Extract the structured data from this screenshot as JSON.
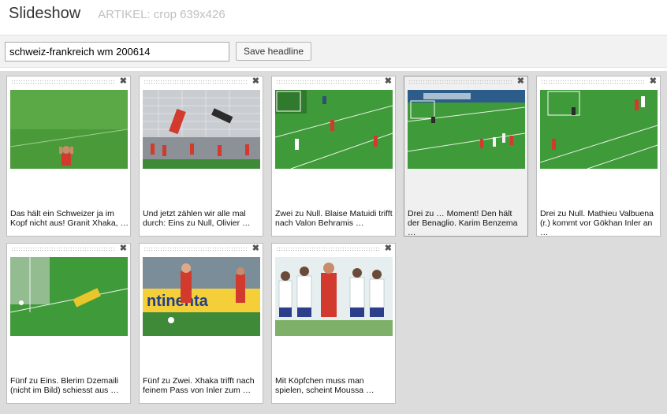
{
  "header": {
    "title": "Slideshow",
    "subtitle": "ARTIKEL: crop 639x426"
  },
  "toolbar": {
    "headline_value": "schweiz-frankreich wm 200614",
    "save_label": "Save headline"
  },
  "slides": [
    {
      "caption": "Das hält ein Schweizer ja im Kopf nicht aus! Granit Xhaka, …",
      "close": "✖"
    },
    {
      "caption": "Und jetzt zählen wir alle mal durch: Eins zu Null, Olivier …",
      "close": "✖"
    },
    {
      "caption": "Zwei zu Null. Blaise Matuidi trifft nach Valon Behramis …",
      "close": "✖"
    },
    {
      "caption": "Drei zu … Moment! Den hält der Benaglio. Karim Benzema …",
      "close": "✖"
    },
    {
      "caption": "Drei zu Null. Mathieu Valbuena (r.) kommt vor Gökhan Inler an …",
      "close": "✖"
    },
    {
      "caption": "Fünf zu Eins. Blerim Dzemaili (nicht im Bild) schiesst aus …",
      "close": "✖"
    },
    {
      "caption": "Fünf zu Zwei. Xhaka trifft nach feinem Pass von Inler zum …",
      "close": "✖"
    },
    {
      "caption": "Mit Köpfchen muss man spielen, scheint Moussa …",
      "close": "✖"
    }
  ]
}
